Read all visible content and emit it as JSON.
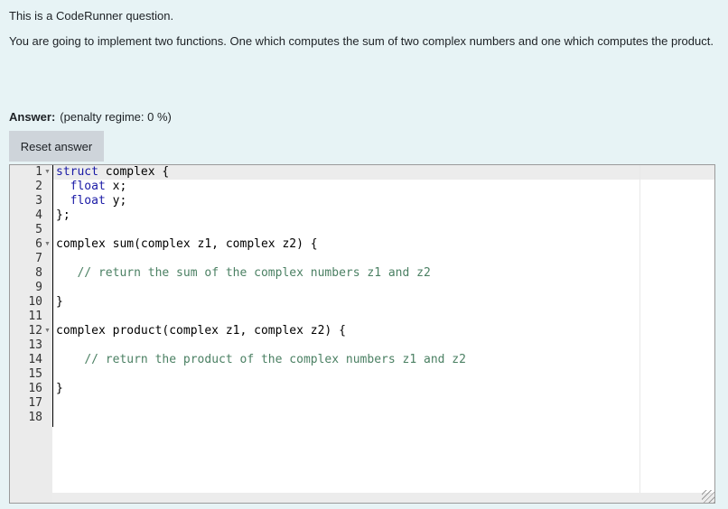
{
  "question": {
    "intro": "This is a CodeRunner question.",
    "description": "You are going to implement two functions. One which computes the sum of two complex numbers and one which computes the product."
  },
  "answer": {
    "label": "Answer:",
    "penalty": "(penalty regime: 0 %)",
    "reset_label": "Reset answer"
  },
  "editor": {
    "colors": {
      "keyword": "#1a1aa6",
      "comment": "#4b8063"
    },
    "lines": [
      {
        "n": "1",
        "fold": true,
        "segs": [
          {
            "t": "struct",
            "c": "kw"
          },
          {
            "t": " complex {",
            "c": ""
          }
        ]
      },
      {
        "n": "2",
        "fold": false,
        "segs": [
          {
            "t": "  ",
            "c": ""
          },
          {
            "t": "float",
            "c": "kw"
          },
          {
            "t": " x;",
            "c": ""
          }
        ]
      },
      {
        "n": "3",
        "fold": false,
        "segs": [
          {
            "t": "  ",
            "c": ""
          },
          {
            "t": "float",
            "c": "kw"
          },
          {
            "t": " y;",
            "c": ""
          }
        ]
      },
      {
        "n": "4",
        "fold": false,
        "segs": [
          {
            "t": "};",
            "c": ""
          }
        ]
      },
      {
        "n": "5",
        "fold": false,
        "segs": []
      },
      {
        "n": "6",
        "fold": true,
        "segs": [
          {
            "t": "complex sum(complex z1, complex z2) {",
            "c": ""
          }
        ]
      },
      {
        "n": "7",
        "fold": false,
        "segs": []
      },
      {
        "n": "8",
        "fold": false,
        "segs": [
          {
            "t": "   ",
            "c": ""
          },
          {
            "t": "// return the sum of the complex numbers z1 and z2",
            "c": "cm"
          }
        ]
      },
      {
        "n": "9",
        "fold": false,
        "segs": []
      },
      {
        "n": "10",
        "fold": false,
        "segs": [
          {
            "t": "}",
            "c": ""
          }
        ]
      },
      {
        "n": "11",
        "fold": false,
        "segs": []
      },
      {
        "n": "12",
        "fold": true,
        "segs": [
          {
            "t": "complex product(complex z1, complex z2) {",
            "c": ""
          }
        ]
      },
      {
        "n": "13",
        "fold": false,
        "segs": []
      },
      {
        "n": "14",
        "fold": false,
        "segs": [
          {
            "t": "    ",
            "c": ""
          },
          {
            "t": "// return the product of the complex numbers z1 and z2",
            "c": "cm"
          }
        ]
      },
      {
        "n": "15",
        "fold": false,
        "segs": []
      },
      {
        "n": "16",
        "fold": false,
        "segs": [
          {
            "t": "}",
            "c": ""
          }
        ]
      },
      {
        "n": "17",
        "fold": false,
        "segs": []
      },
      {
        "n": "18",
        "fold": false,
        "segs": []
      }
    ]
  }
}
